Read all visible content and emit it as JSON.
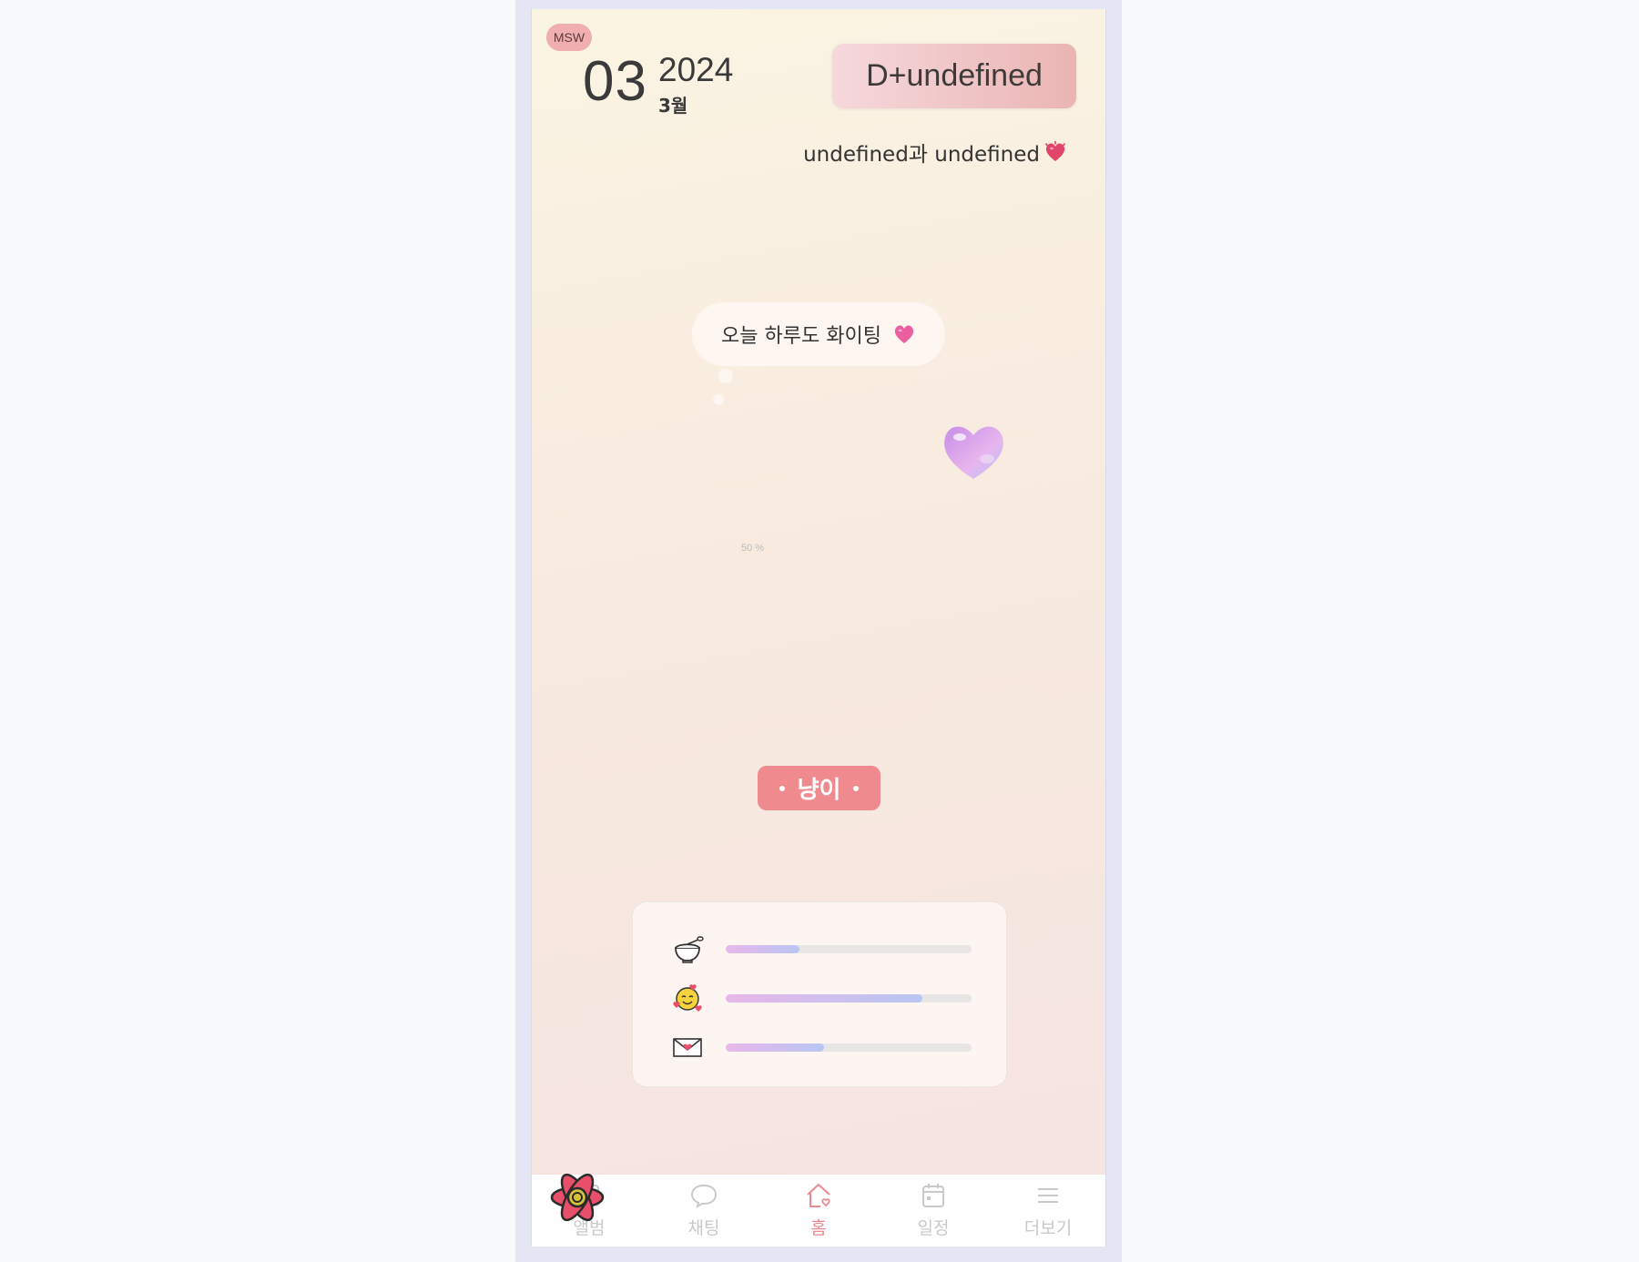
{
  "header": {
    "msw_badge": "MSW",
    "day": "03",
    "year": "2024",
    "month": "3월",
    "dday": "D+undefined",
    "couple": "undefined과 undefined"
  },
  "main": {
    "bubble_text": "오늘 하루도 화이팅",
    "progress_text": "50 %",
    "pet_name": "냥이"
  },
  "stats": [
    {
      "icon": "rice-bowl-icon",
      "fill": 0.3
    },
    {
      "icon": "smiling-face-hearts-icon",
      "fill": 0.8
    },
    {
      "icon": "love-letter-icon",
      "fill": 0.4
    }
  ],
  "nav": {
    "items": [
      {
        "label": "앨범",
        "icon": "album-icon"
      },
      {
        "label": "채팅",
        "icon": "chat-icon"
      },
      {
        "label": "홈",
        "icon": "home-icon",
        "active": true
      },
      {
        "label": "일정",
        "icon": "calendar-icon"
      },
      {
        "label": "더보기",
        "icon": "menu-icon"
      }
    ]
  },
  "colors": {
    "accent": "#ef8b8f",
    "heart": "#e0466a",
    "nav_active": "#e98b8f"
  }
}
